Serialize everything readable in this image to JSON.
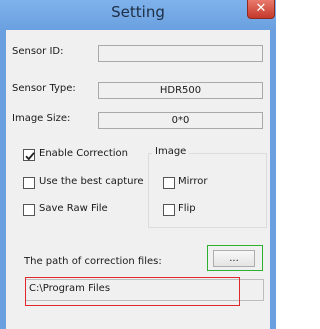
{
  "window": {
    "title": "Setting",
    "close_glyph": "✕"
  },
  "fields": {
    "sensor_id": {
      "label": "Sensor ID:",
      "value": ""
    },
    "sensor_type": {
      "label": "Sensor Type:",
      "value": "HDR500"
    },
    "image_size": {
      "label": "Image Size:",
      "value": "0*0"
    }
  },
  "options": {
    "enable_correction": {
      "label": "Enable Correction",
      "checked": true
    },
    "use_best_capture": {
      "label": "Use the best capture",
      "checked": false
    },
    "save_raw_file": {
      "label": "Save Raw File",
      "checked": false
    }
  },
  "image_group": {
    "title": "Image",
    "mirror": {
      "label": "Mirror",
      "checked": false
    },
    "flip": {
      "label": "Flip",
      "checked": false
    }
  },
  "correction_path": {
    "label": "The path of correction files:",
    "browse_label": "...",
    "value": "C:\\Program Files"
  },
  "colors": {
    "title_bar": "#6aa0e0",
    "close_button": "#c4392b",
    "highlight_green": "#2fb12f",
    "highlight_red": "#e0282a"
  }
}
